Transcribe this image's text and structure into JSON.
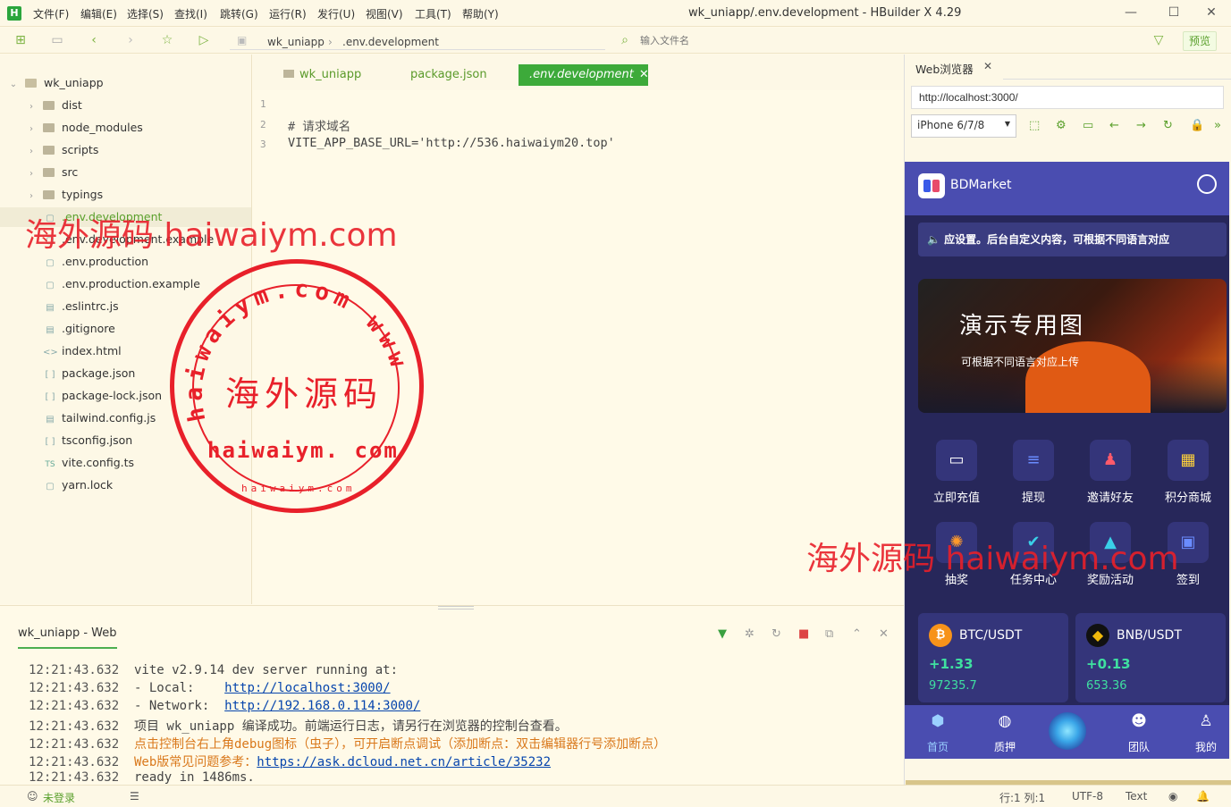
{
  "window": {
    "title": "wk_uniapp/.env.development - HBuilder X 4.29",
    "logo": "H",
    "menu": [
      "文件(F)",
      "编辑(E)",
      "选择(S)",
      "查找(I)",
      "跳转(G)",
      "运行(R)",
      "发行(U)",
      "视图(V)",
      "工具(T)",
      "帮助(Y)"
    ],
    "controls": {
      "minimize": "—",
      "maximize": "☐",
      "close": "✕"
    }
  },
  "toolbar": {
    "breadcrumb": [
      "wk_uniapp",
      ".env.development"
    ],
    "file_input_placeholder": "输入文件名",
    "preview_label": "预览"
  },
  "sidebar": {
    "root": "wk_uniapp",
    "items": [
      {
        "name": "dist",
        "type": "folder"
      },
      {
        "name": "node_modules",
        "type": "folder"
      },
      {
        "name": "scripts",
        "type": "folder"
      },
      {
        "name": "src",
        "type": "folder"
      },
      {
        "name": "typings",
        "type": "folder"
      },
      {
        "name": ".env.development",
        "type": "file",
        "selected": true
      },
      {
        "name": ".env.development.example",
        "type": "file"
      },
      {
        "name": ".env.production",
        "type": "file"
      },
      {
        "name": ".env.production.example",
        "type": "file"
      },
      {
        "name": ".eslintrc.js",
        "type": "file"
      },
      {
        "name": ".gitignore",
        "type": "file"
      },
      {
        "name": "index.html",
        "type": "file"
      },
      {
        "name": "package.json",
        "type": "file"
      },
      {
        "name": "package-lock.json",
        "type": "file"
      },
      {
        "name": "tailwind.config.js",
        "type": "file"
      },
      {
        "name": "tsconfig.json",
        "type": "file"
      },
      {
        "name": "vite.config.ts",
        "type": "file"
      },
      {
        "name": "yarn.lock",
        "type": "file"
      }
    ]
  },
  "editor": {
    "tabs": [
      {
        "label": "wk_uniapp"
      },
      {
        "label": "package.json"
      },
      {
        "label": ".env.development",
        "active": true
      }
    ],
    "lines": [
      {
        "n": "1",
        "text": ""
      },
      {
        "n": "2",
        "text": "# 请求域名"
      },
      {
        "n": "3",
        "text": "VITE_APP_BASE_URL='http://536.haiwaiym20.top'"
      }
    ]
  },
  "panel": {
    "tab": "wk_uniapp - Web",
    "logs": [
      {
        "ts": "12:21:43.632",
        "text": "vite v2.9.14 dev server running at:"
      },
      {
        "ts": "12:21:43.632",
        "pre": "- Local:    ",
        "link": "http://localhost:3000/"
      },
      {
        "ts": "12:21:43.632",
        "pre": "- Network:  ",
        "link": "http://192.168.0.114:3000/"
      },
      {
        "ts": "12:21:43.632",
        "text": "项目 wk_uniapp 编译成功。前端运行日志，请另行在浏览器的控制台查看。"
      },
      {
        "ts": "12:21:43.632",
        "orange": "点击控制台右上角debug图标（虫子），可开启断点调试（添加断点：双击编辑器行号添加断点）"
      },
      {
        "ts": "12:21:43.632",
        "orange": "Web版常见问题参考：",
        "link": "https://ask.dcloud.net.cn/article/35232"
      },
      {
        "ts": "12:21:43.632",
        "text": "ready in 1486ms."
      }
    ]
  },
  "statusbar": {
    "login": "未登录",
    "position": "行:1  列:1",
    "encoding": "UTF-8",
    "syntax": "Text"
  },
  "browser": {
    "tab": "Web浏览器",
    "url": "http://localhost:3000/",
    "device": "iPhone 6/7/8"
  },
  "app": {
    "name": "BDMarket",
    "notice": "应设置。后台自定义内容，可根据不同语言对应",
    "banner_title": "演示专用图",
    "banner_sub": "可根据不同语言对应上传",
    "grid": [
      "立即充值",
      "提现",
      "邀请好友",
      "积分商城",
      "抽奖",
      "任务中心",
      "奖励活动",
      "签到"
    ],
    "coins": [
      {
        "pair": "BTC/USDT",
        "change": "+1.33",
        "price": "97235.7",
        "color": "#f7931a"
      },
      {
        "pair": "BNB/USDT",
        "change": "+0.13",
        "price": "653.36",
        "color": "#f0b90b"
      }
    ],
    "nav": [
      "首页",
      "质押",
      "团队",
      "我的"
    ]
  },
  "watermarks": {
    "top": "海外源码 haiwaiym.com",
    "mid": "海外源码 haiwaiym.com",
    "stamp_ring": "haiwaiym.com  www",
    "stamp_center": "海外源码",
    "stamp_url": "haiwaiym. com",
    "stamp_small": "haiwaiym.com"
  }
}
